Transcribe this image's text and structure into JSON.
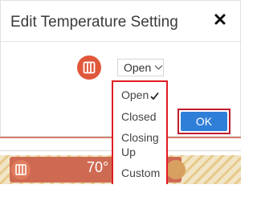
{
  "dialog": {
    "title": "Edit Temperature Setting",
    "close_icon": "close-icon",
    "mode_icon": "system-mode-icon"
  },
  "select": {
    "value": "Open",
    "chevron_icon": "chevron-down-icon",
    "options": [
      {
        "label": "Open",
        "selected": true
      },
      {
        "label": "Closed",
        "selected": false
      },
      {
        "label": "Closing Up",
        "selected": false
      },
      {
        "label": "Custom",
        "selected": false
      }
    ]
  },
  "buttons": {
    "ok": "OK"
  },
  "background": {
    "temperature": "70°"
  },
  "colors": {
    "accent": "#2f7fd9",
    "highlight_border": "#e11d23",
    "mode_icon_bg": "#e0573a",
    "band": "#cf6a52"
  }
}
